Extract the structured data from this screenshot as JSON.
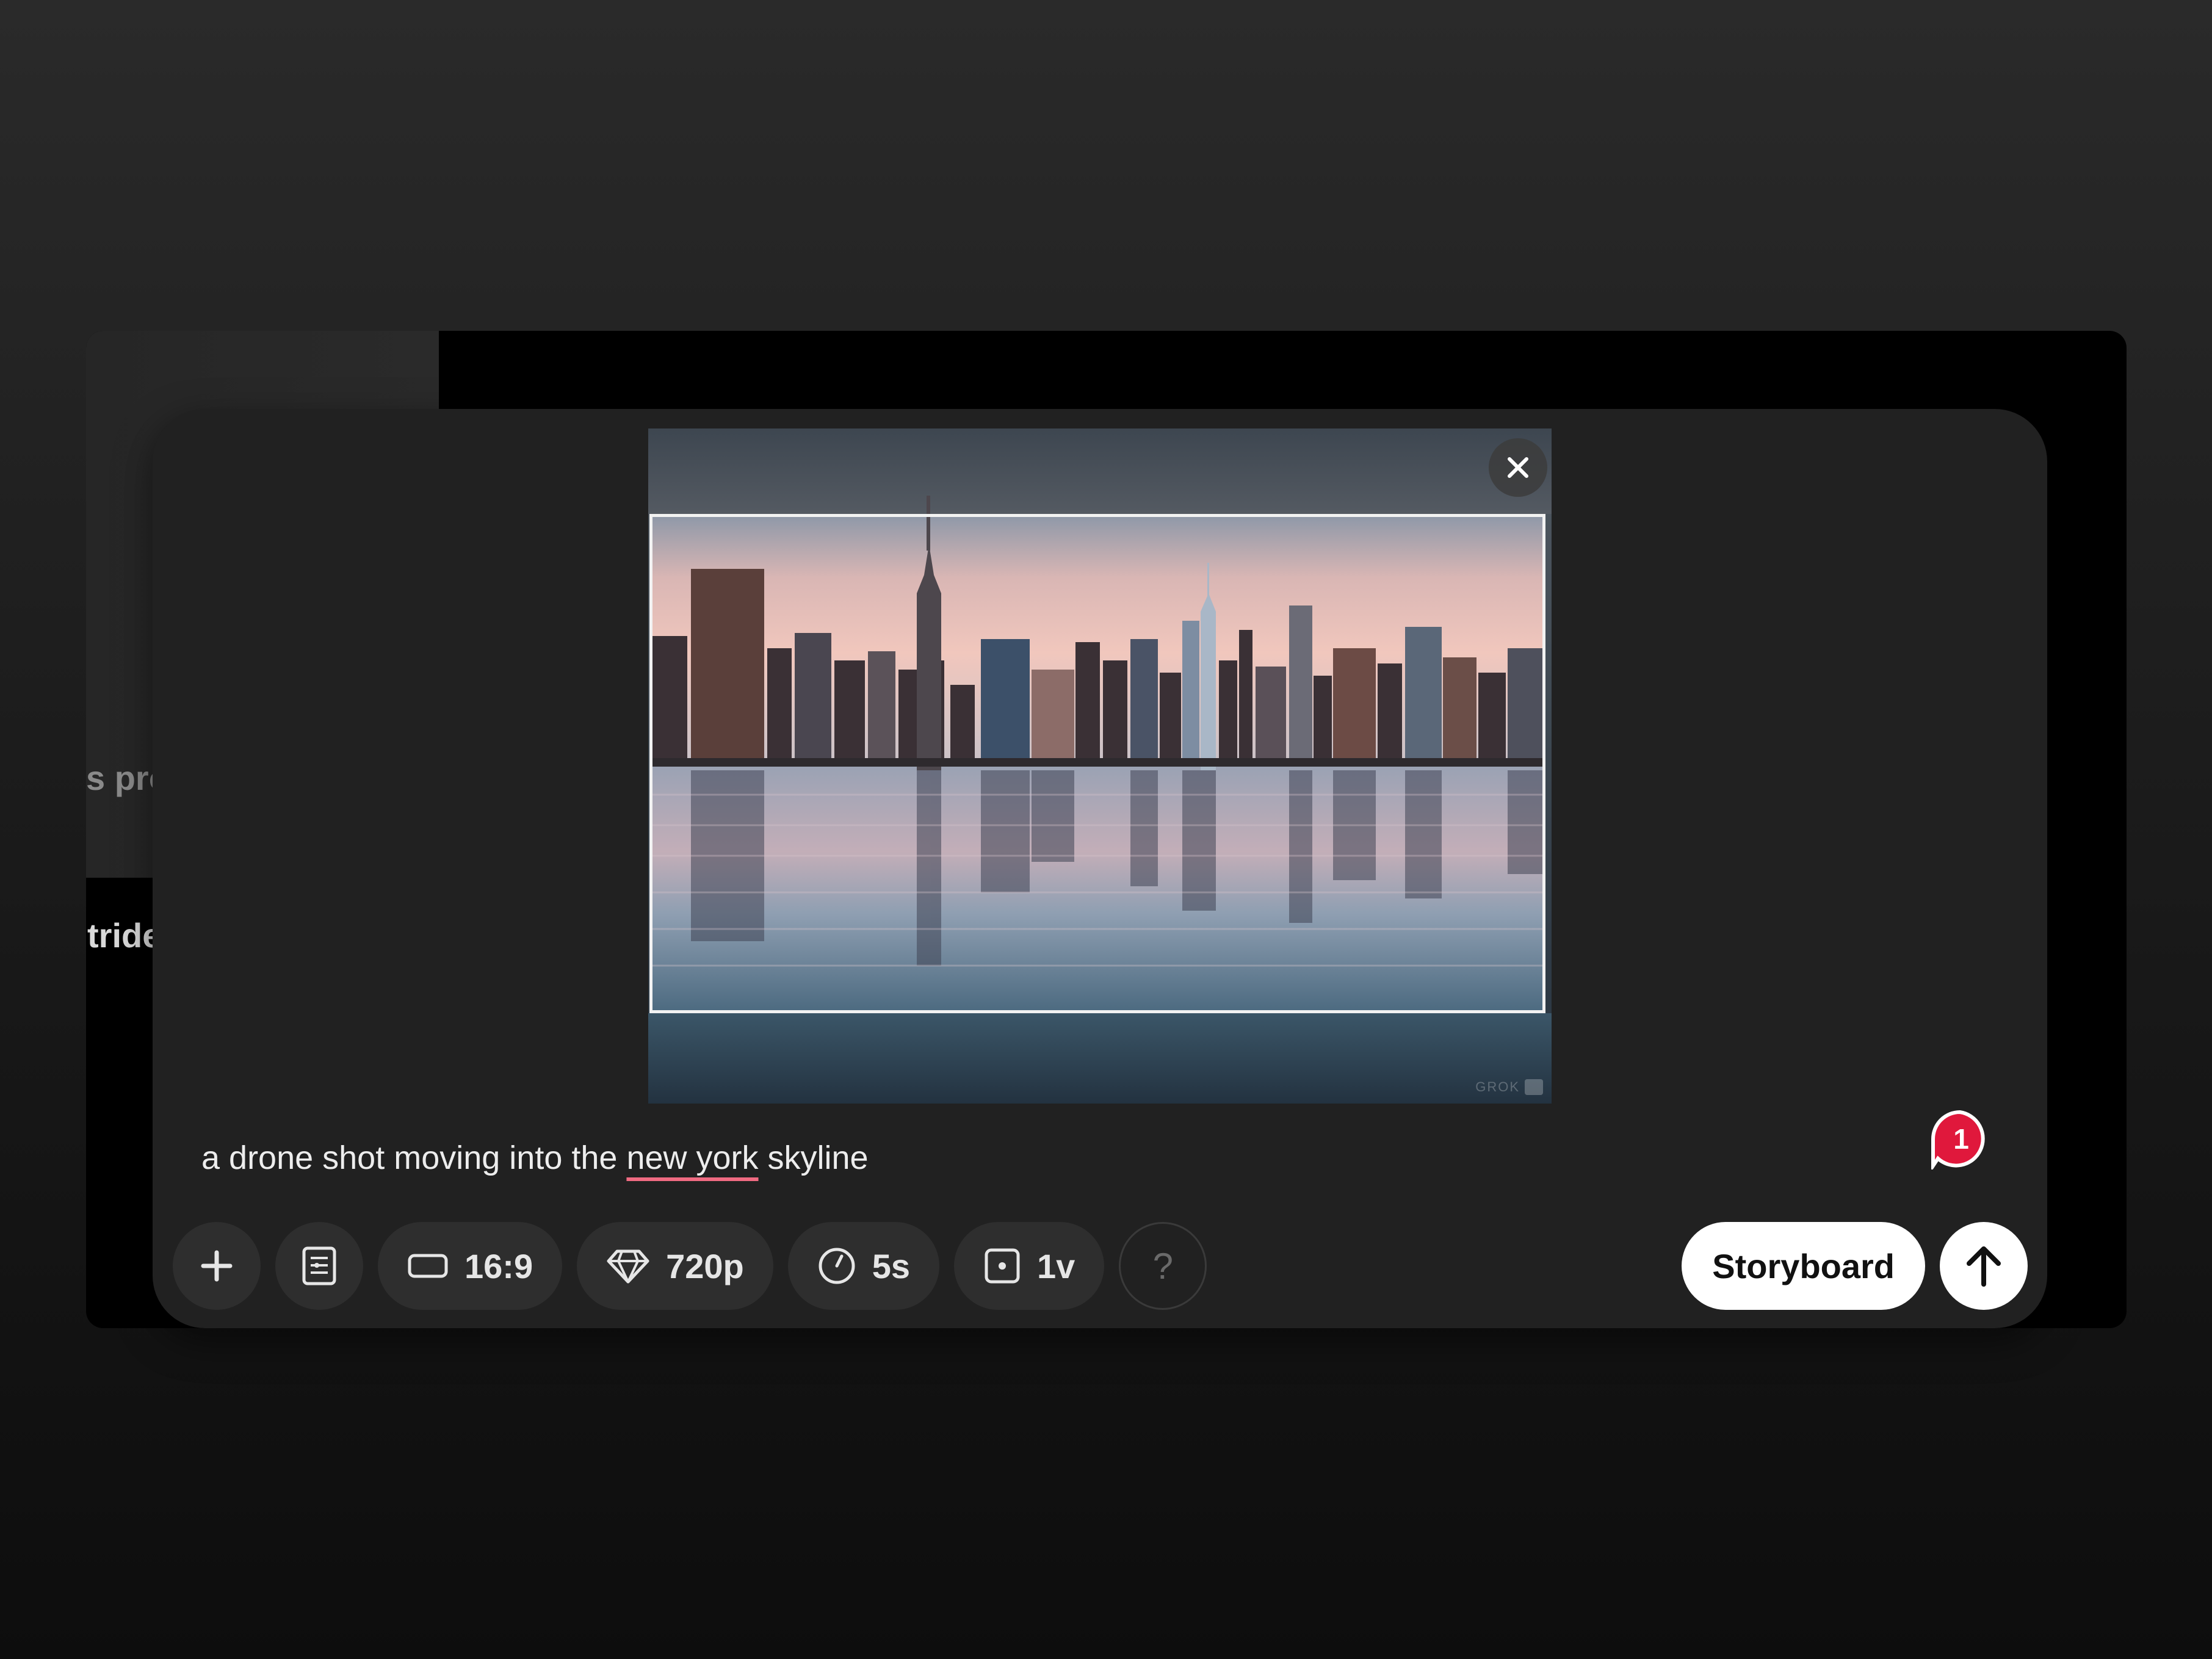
{
  "background": {
    "sidebar_text_1": "s pro",
    "sidebar_text_2": "tride"
  },
  "preview": {
    "watermark": "GROK"
  },
  "prompt": {
    "before": "a drone shot moving into the ",
    "flagged": "new york",
    "after": " skyline"
  },
  "notification": {
    "count": "1",
    "color": "#e0183c"
  },
  "toolbar": {
    "aspect_ratio": "16:9",
    "resolution": "720p",
    "duration": "5s",
    "variations": "1v",
    "help": "?"
  },
  "actions": {
    "storyboard_label": "Storyboard"
  }
}
